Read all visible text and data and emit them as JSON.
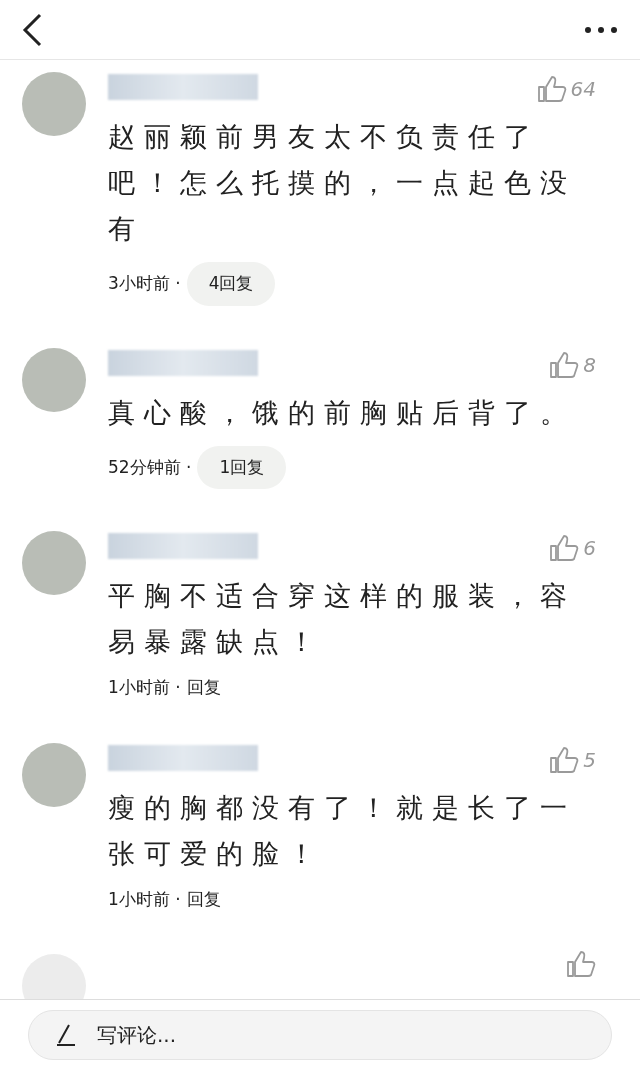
{
  "comments": [
    {
      "text": "赵丽颖前男友太不负责任了吧！怎么托摸的，一点起色没有",
      "likes": "64",
      "time": "3小时前 ·",
      "reply": "4回复",
      "kind": "pill"
    },
    {
      "text": "真心酸，饿的前胸贴后背了。",
      "likes": "8",
      "time": "52分钟前 ·",
      "reply": "1回复",
      "kind": "pill"
    },
    {
      "text": "平胸不适合穿这样的服装，容易暴露缺点！",
      "likes": "6",
      "time": "1小时前 ·",
      "reply": "回复",
      "kind": "plain"
    },
    {
      "text": "瘦的胸都没有了！就是长了一张可爱的脸！",
      "likes": "5",
      "time": "1小时前 ·",
      "reply": "回复",
      "kind": "plain"
    }
  ],
  "composer": {
    "placeholder": "写评论..."
  }
}
